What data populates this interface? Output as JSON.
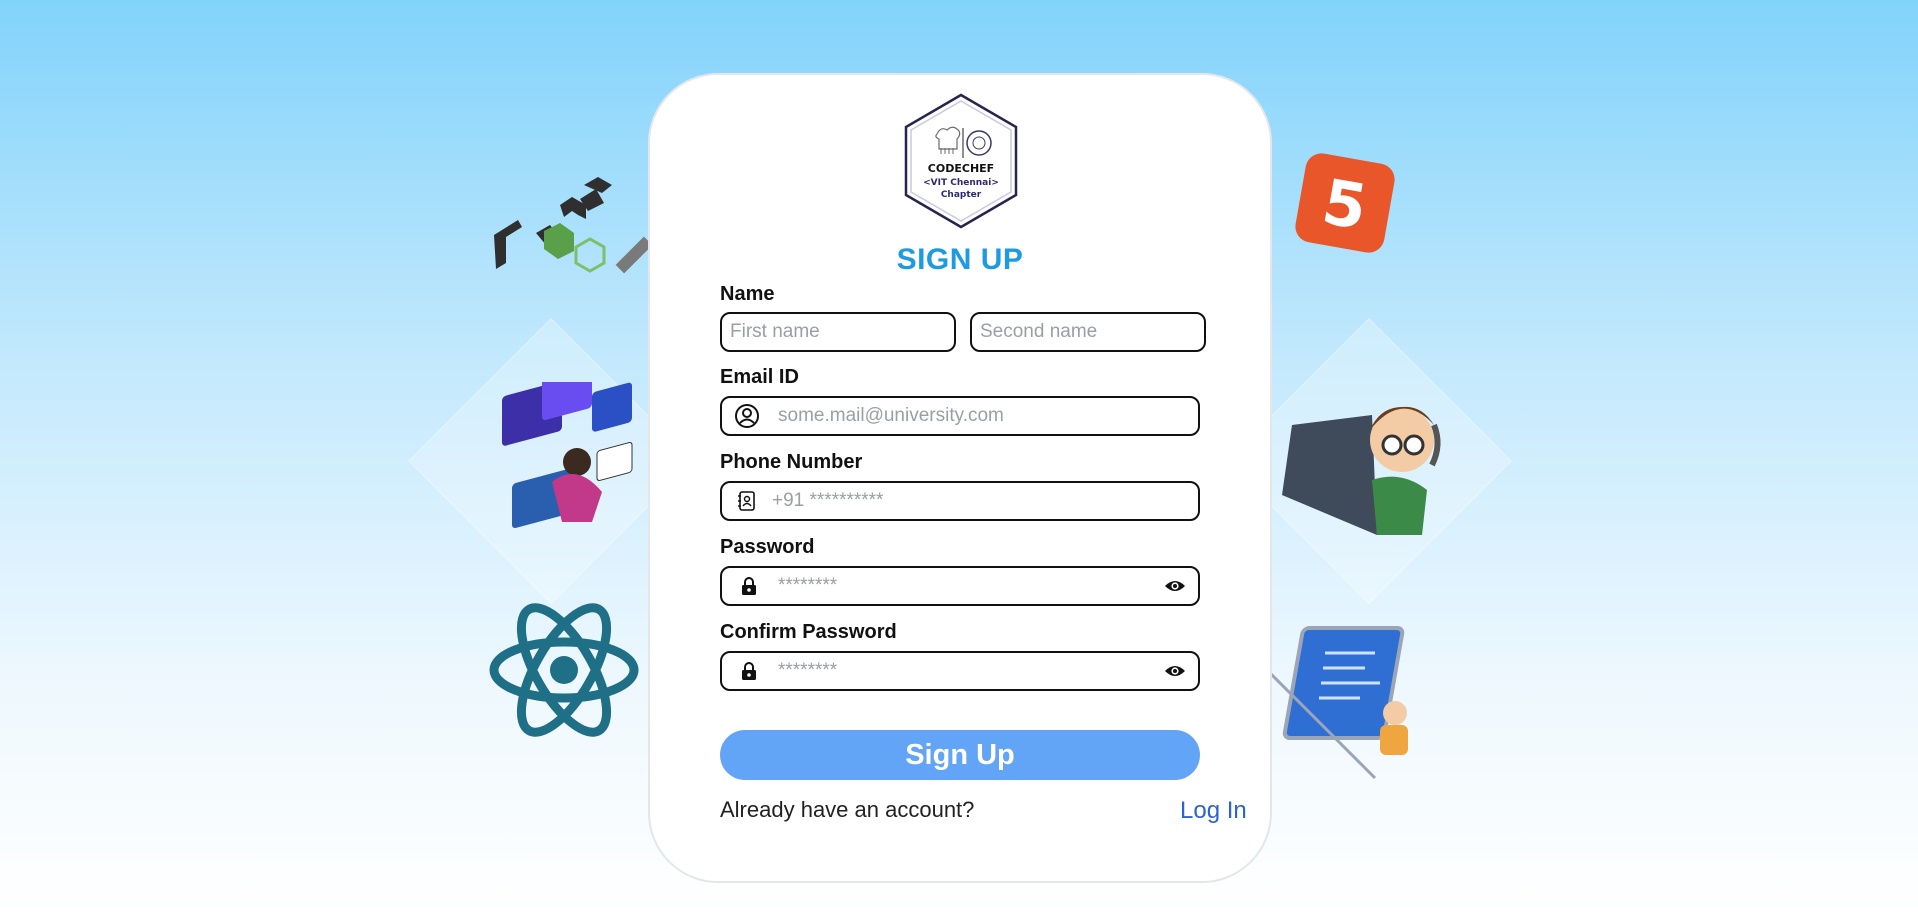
{
  "title": "SIGN UP",
  "logo": {
    "line1": "CODECHEF",
    "line2": "<VIT Chennai>",
    "line3": "Chapter"
  },
  "form": {
    "name_label": "Name",
    "first_name_placeholder": "First name",
    "second_name_placeholder": "Second name",
    "email_label": "Email ID",
    "email_placeholder": "some.mail@university.com",
    "phone_label": "Phone Number",
    "phone_placeholder": "+91 **********",
    "password_label": "Password",
    "password_placeholder": "********",
    "confirm_label": "Confirm Password",
    "confirm_placeholder": "********"
  },
  "signup_button": "Sign Up",
  "footer": {
    "prompt": "Already have an account?",
    "login_link": "Log In"
  },
  "colors": {
    "accent_title": "#1e9be0",
    "button": "#62a4f5",
    "link": "#2a63d2"
  }
}
